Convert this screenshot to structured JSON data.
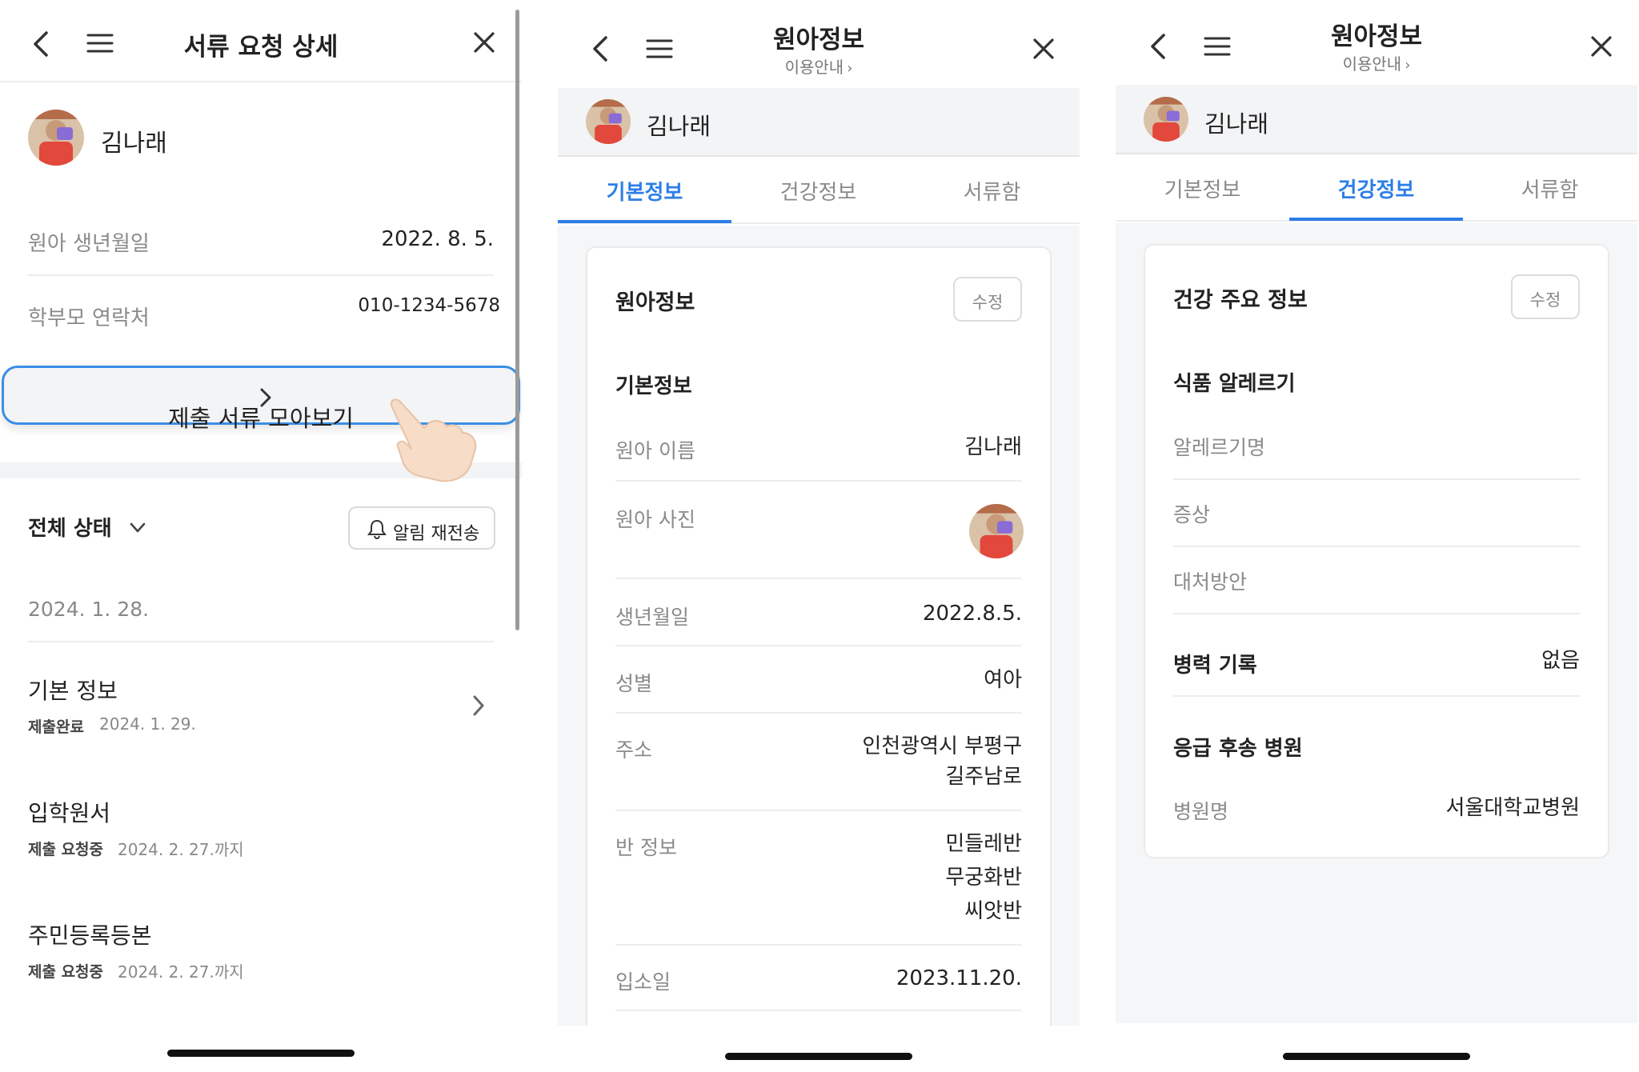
{
  "screen1": {
    "title": "서류 요청 상세",
    "child_name": "김나래",
    "birth_label": "원아 생년월일",
    "birth_value": "2022. 8. 5.",
    "contact_label": "학부모 연락처",
    "contact_value": "010-1234-5678",
    "collect_button": "제출 서류 모아보기",
    "status_label": "전체 상태",
    "resend_label": "알림 재전송",
    "date_header": "2024. 1. 28.",
    "documents": [
      {
        "title": "기본 정보",
        "status": "제출완료",
        "date": "2024. 1. 29."
      },
      {
        "title": "입학원서",
        "status": "제출 요청중",
        "date": "2024. 2. 27.까지"
      },
      {
        "title": "주민등록등본",
        "status": "제출 요청중",
        "date": "2024. 2. 27.까지"
      }
    ]
  },
  "screen2": {
    "title": "원아정보",
    "subtitle": "이용안내",
    "child_name": "김나래",
    "tabs": [
      "기본정보",
      "건강정보",
      "서류함"
    ],
    "active_tab": 0,
    "card_title": "원아정보",
    "edit_label": "수정",
    "section_title": "기본정보",
    "rows": {
      "name_label": "원아 이름",
      "name_value": "김나래",
      "photo_label": "원아 사진",
      "birth_label": "생년월일",
      "birth_value": "2022.8.5.",
      "gender_label": "성별",
      "gender_value": "여아",
      "address_label": "주소",
      "address_line1": "인천광역시 부평구",
      "address_line2": "길주남로",
      "class_label": "반 정보",
      "class_line1": "민들레반",
      "class_line2": "무궁화반",
      "class_line3": "씨앗반",
      "entry_label": "입소일",
      "entry_value": "2023.11.20."
    }
  },
  "screen3": {
    "title": "원아정보",
    "subtitle": "이용안내",
    "child_name": "김나래",
    "tabs": [
      "기본정보",
      "건강정보",
      "서류함"
    ],
    "active_tab": 1,
    "card_title": "건강 주요 정보",
    "edit_label": "수정",
    "allergy_title": "식품 알레르기",
    "allergy_name_label": "알레르기명",
    "symptom_label": "증상",
    "remedy_label": "대처방안",
    "history_label": "병력 기록",
    "history_value": "없음",
    "hospital_title": "응급 후송 병원",
    "hospital_label": "병원명",
    "hospital_value": "서울대학교병원"
  },
  "colors": {
    "accent": "#2c7ee8",
    "highlight_border": "#3b8ee6",
    "band": "#f3f4f6"
  },
  "icons": [
    "back-icon",
    "menu-icon",
    "close-icon",
    "chevron-right-icon",
    "chevron-down-icon",
    "bell-icon",
    "pointer-hand-icon"
  ]
}
